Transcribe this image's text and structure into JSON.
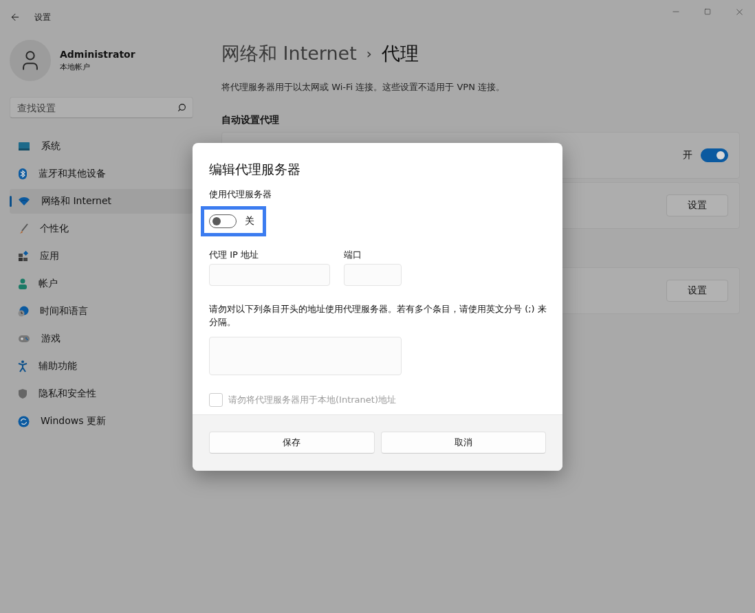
{
  "window": {
    "title": "设置"
  },
  "account": {
    "name": "Administrator",
    "type": "本地帐户"
  },
  "search": {
    "placeholder": "查找设置"
  },
  "sidebar": {
    "items": [
      {
        "label": "系统",
        "kind": "system",
        "selected": false
      },
      {
        "label": "蓝牙和其他设备",
        "kind": "bluetooth",
        "selected": false
      },
      {
        "label": "网络和 Internet",
        "kind": "network",
        "selected": true
      },
      {
        "label": "个性化",
        "kind": "brush",
        "selected": false
      },
      {
        "label": "应用",
        "kind": "apps",
        "selected": false
      },
      {
        "label": "帐户",
        "kind": "account",
        "selected": false
      },
      {
        "label": "时间和语言",
        "kind": "time",
        "selected": false
      },
      {
        "label": "游戏",
        "kind": "gaming",
        "selected": false
      },
      {
        "label": "辅助功能",
        "kind": "accessibility",
        "selected": false
      },
      {
        "label": "隐私和安全性",
        "kind": "privacy",
        "selected": false
      },
      {
        "label": "Windows 更新",
        "kind": "update",
        "selected": false
      }
    ]
  },
  "header": {
    "parent": "网络和 Internet",
    "separator": "›",
    "title": "代理"
  },
  "description": "将代理服务器用于以太网或 Wi-Fi 连接。这些设置不适用于 VPN 连接。",
  "sections": [
    {
      "title": "自动设置代理",
      "cards": [
        {
          "kind": "toggle",
          "state_label": "开",
          "on": true
        },
        {
          "kind": "button",
          "button": "设置"
        }
      ]
    },
    {
      "cards": [
        {
          "kind": "button",
          "button": "设置"
        }
      ]
    }
  ],
  "dialog": {
    "title": "编辑代理服务器",
    "use_proxy": {
      "label": "使用代理服务器",
      "on": false,
      "state_label": "关",
      "highlighted": true
    },
    "address": {
      "label": "代理 IP 地址"
    },
    "port": {
      "label": "端口"
    },
    "exceptions": {
      "label": "请勿对以下列条目开头的地址使用代理服务器。若有多个条目，请使用英文分号 (;) 来分隔。"
    },
    "local": {
      "label": "请勿将代理服务器用于本地(Intranet)地址",
      "checked": false,
      "disabled": true
    },
    "buttons": [
      "保存",
      "取消"
    ]
  }
}
